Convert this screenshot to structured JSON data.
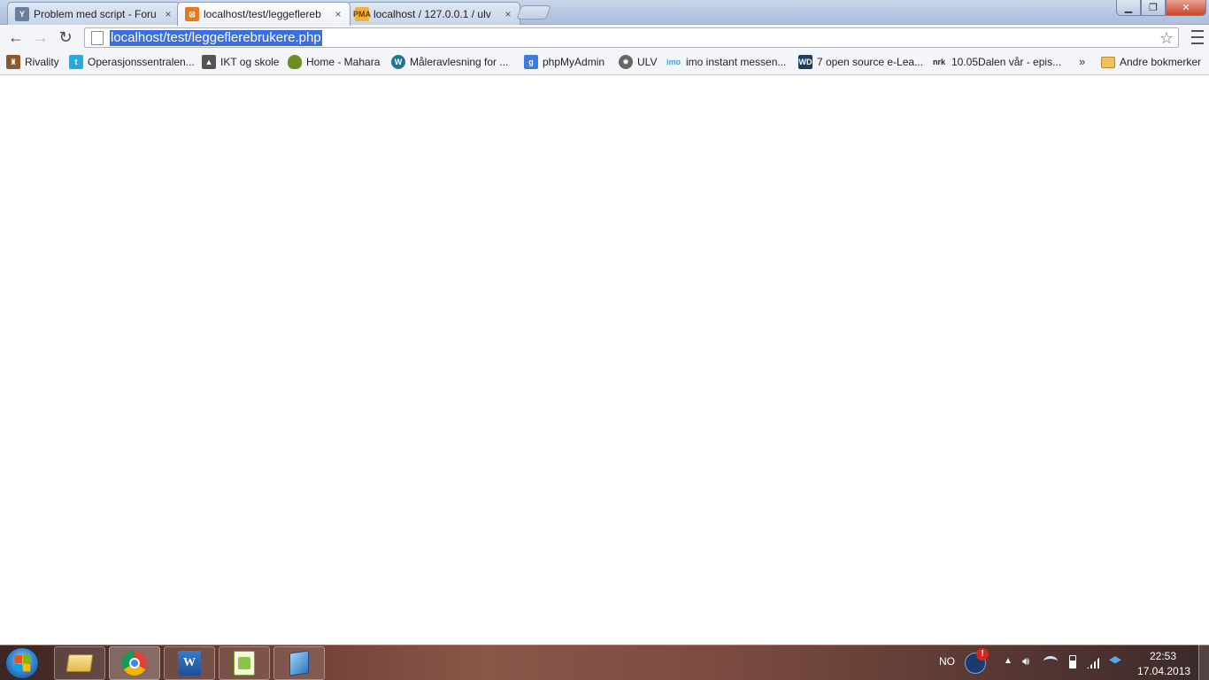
{
  "window": {
    "tabs": [
      {
        "title": "Problem med script - Foru",
        "icon": "forum-icon",
        "active": false
      },
      {
        "title": "localhost/test/leggeflereb",
        "icon": "xampp-icon",
        "active": true
      },
      {
        "title": "localhost / 127.0.0.1 / ulv",
        "icon": "phpmyadmin-icon",
        "active": false
      }
    ],
    "close_glyph": "×",
    "controls": {
      "minimize": "▁",
      "maximize": "❐",
      "close": "✕"
    }
  },
  "toolbar": {
    "back": "←",
    "forward": "→",
    "reload": "↻",
    "url": "localhost/test/leggeflerebrukere.php",
    "star": "☆"
  },
  "bookmarks": {
    "items": [
      {
        "label": "Rivality",
        "icon": "rivality-icon",
        "color": "#8a5a2b"
      },
      {
        "label": "Operasjonssentralen...",
        "icon": "twitter-icon",
        "color": "#2aa9e0"
      },
      {
        "label": "IKT og skole",
        "icon": "graduation-cap-icon",
        "color": "#555555"
      },
      {
        "label": "Home - Mahara",
        "icon": "mahara-icon",
        "color": "#6b8e23"
      },
      {
        "label": "Måleravlesning for ...",
        "icon": "wordpress-icon",
        "color": "#21759b"
      },
      {
        "label": "phpMyAdmin",
        "icon": "google-g-icon",
        "color": "#3b7ddd"
      },
      {
        "label": "ULV",
        "icon": "gear-icon",
        "color": "#666666"
      },
      {
        "label": "imo instant messen...",
        "icon": "imo-icon",
        "color": "#4aa3df"
      },
      {
        "label": "7 open source e-Lea...",
        "icon": "wd-icon",
        "color": "#1c3f63"
      },
      {
        "label": "10.05Dalen vår - epis...",
        "icon": "nrk-icon",
        "color": "#222222"
      }
    ],
    "overflow": "»",
    "other": "Andre bokmerker"
  },
  "taskbar": {
    "apps": [
      {
        "name": "taskbar-explorer",
        "icon": "folder-icon"
      },
      {
        "name": "taskbar-chrome",
        "icon": "chrome-icon"
      },
      {
        "name": "taskbar-word",
        "icon": "word-icon"
      },
      {
        "name": "taskbar-notepadpp",
        "icon": "notepad-plus-icon"
      },
      {
        "name": "taskbar-app5",
        "icon": "blue-app-icon"
      }
    ],
    "language": "NO",
    "time": "22:53",
    "date": "17.04.2013"
  }
}
